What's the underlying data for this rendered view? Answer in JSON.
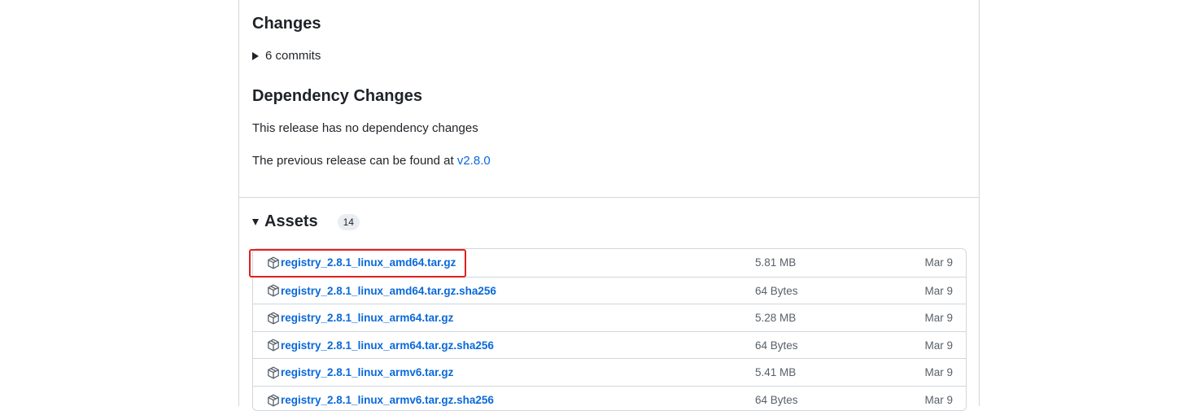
{
  "release": {
    "changes_heading": "Changes",
    "commits_label": "6 commits",
    "dependency_heading": "Dependency Changes",
    "no_dependency_text": "This release has no dependency changes",
    "previous_release_text": "The previous release can be found at ",
    "previous_release_link": "v2.8.0"
  },
  "assets": {
    "heading": "Assets",
    "count": "14",
    "items": [
      {
        "name": "registry_2.8.1_linux_amd64.tar.gz",
        "size": "5.81 MB",
        "date": "Mar 9"
      },
      {
        "name": "registry_2.8.1_linux_amd64.tar.gz.sha256",
        "size": "64 Bytes",
        "date": "Mar 9"
      },
      {
        "name": "registry_2.8.1_linux_arm64.tar.gz",
        "size": "5.28 MB",
        "date": "Mar 9"
      },
      {
        "name": "registry_2.8.1_linux_arm64.tar.gz.sha256",
        "size": "64 Bytes",
        "date": "Mar 9"
      },
      {
        "name": "registry_2.8.1_linux_armv6.tar.gz",
        "size": "5.41 MB",
        "date": "Mar 9"
      },
      {
        "name": "registry_2.8.1_linux_armv6.tar.gz.sha256",
        "size": "64 Bytes",
        "date": "Mar 9"
      }
    ]
  },
  "colors": {
    "link": "#0969da",
    "highlight_border": "#e0201f",
    "border": "#d0d7de"
  },
  "icons": {
    "asset": "package-icon",
    "expand": "triangle-right-icon",
    "collapse": "triangle-down-icon"
  }
}
